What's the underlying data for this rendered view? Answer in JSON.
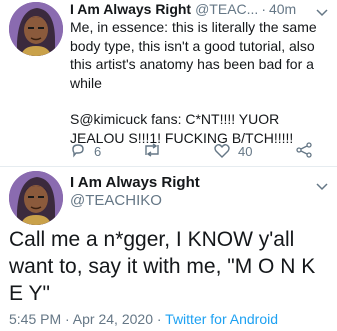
{
  "tweet1": {
    "author_name": "I Am Always Right",
    "handle": "@TEAC...",
    "separator": "·",
    "time": "40m",
    "text_line1": "Me, in essence: this is literally the same body type, this isn't a good tutorial, also this artist's anatomy has been bad for a while",
    "text_line2": "S@kimicuck fans: C*NT!!!! YUOR JEALOU S!!!1! FUCKING B/TCH!!!!!",
    "reply_count": "6",
    "like_count": "40"
  },
  "tweet2": {
    "author_name": "I Am Always Right",
    "handle": "@TEACHIKO",
    "text": "Call me a n*gger, I KNOW y'all want to, say it with me, \"M O N K E Y\"",
    "timestamp": "5:45 PM · Apr 24, 2020 · ",
    "source": "Twitter for Android"
  },
  "colors": {
    "text": "#14171a",
    "muted": "#657786",
    "link": "#1da1f2",
    "divider": "#e6ecf0"
  }
}
